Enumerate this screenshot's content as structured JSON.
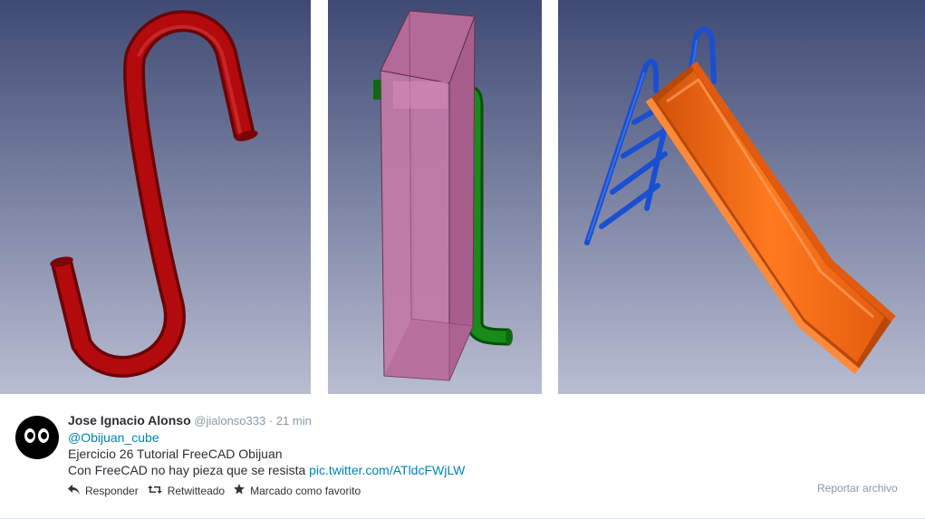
{
  "media": {
    "panels": [
      {
        "name": "s-hook-render"
      },
      {
        "name": "box-pipe-render"
      },
      {
        "name": "slide-render"
      }
    ]
  },
  "tweet": {
    "fullname": "Jose Ignacio Alonso",
    "username": "@jialonso333",
    "separator": "·",
    "time": "21 min",
    "mention": "@Obijuan_cube",
    "line1": "Ejercicio 26 Tutorial FreeCAD Obijuan",
    "line2_text": "Con FreeCAD no hay pieza que se resista",
    "link": "pic.twitter.com/ATldcFWjLW",
    "actions": {
      "reply": "Responder",
      "retweet": "Retwitteado",
      "favorite": "Marcado como favorito"
    },
    "report": "Reportar archivo"
  },
  "colors": {
    "viewport_top": "#3f4a74",
    "viewport_bottom": "#b9bdd2",
    "hook": "#a3070a",
    "box": "#c47aa8",
    "pipe": "#0f7a0f",
    "slide": "#f26b16",
    "ladder": "#1b4fd1",
    "link": "#0084b4"
  }
}
